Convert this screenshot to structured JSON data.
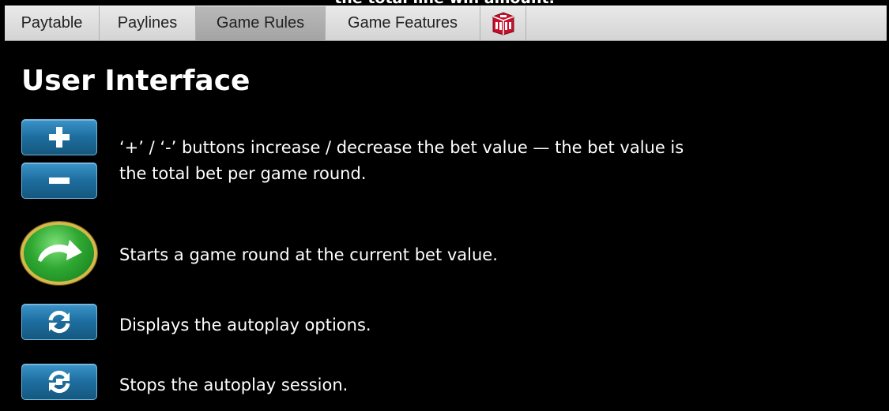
{
  "top_clipped_text": "the total line win amount.",
  "tabs": [
    {
      "label": "Paytable",
      "active": false
    },
    {
      "label": "Paylines",
      "active": false
    },
    {
      "label": "Game Rules",
      "active": true
    },
    {
      "label": "Game Features",
      "active": false
    }
  ],
  "logo_icon": "dice-logo-icon",
  "title": "User Interface",
  "items": [
    {
      "icons": [
        "plus-icon",
        "minus-icon"
      ],
      "text_line1": "‘+’ / ‘-’ buttons increase / decrease the bet value — the bet value is",
      "text_line2": "the total bet per game round."
    },
    {
      "icons": [
        "spin-arrow-icon"
      ],
      "text": "Starts a game round at the current bet value."
    },
    {
      "icons": [
        "autoplay-icon"
      ],
      "text": "Displays the autoplay options."
    },
    {
      "icons": [
        "stop-autoplay-icon"
      ],
      "text": "Stops the autoplay session."
    }
  ],
  "colors": {
    "background": "#000000",
    "tab_bar": "#d9d9d9",
    "active_tab": "#aeaeae",
    "button_blue": "#1d6d9e",
    "spin_green": "#2fa832",
    "spin_rim": "#d8b84a",
    "logo_red": "#c8102e"
  }
}
